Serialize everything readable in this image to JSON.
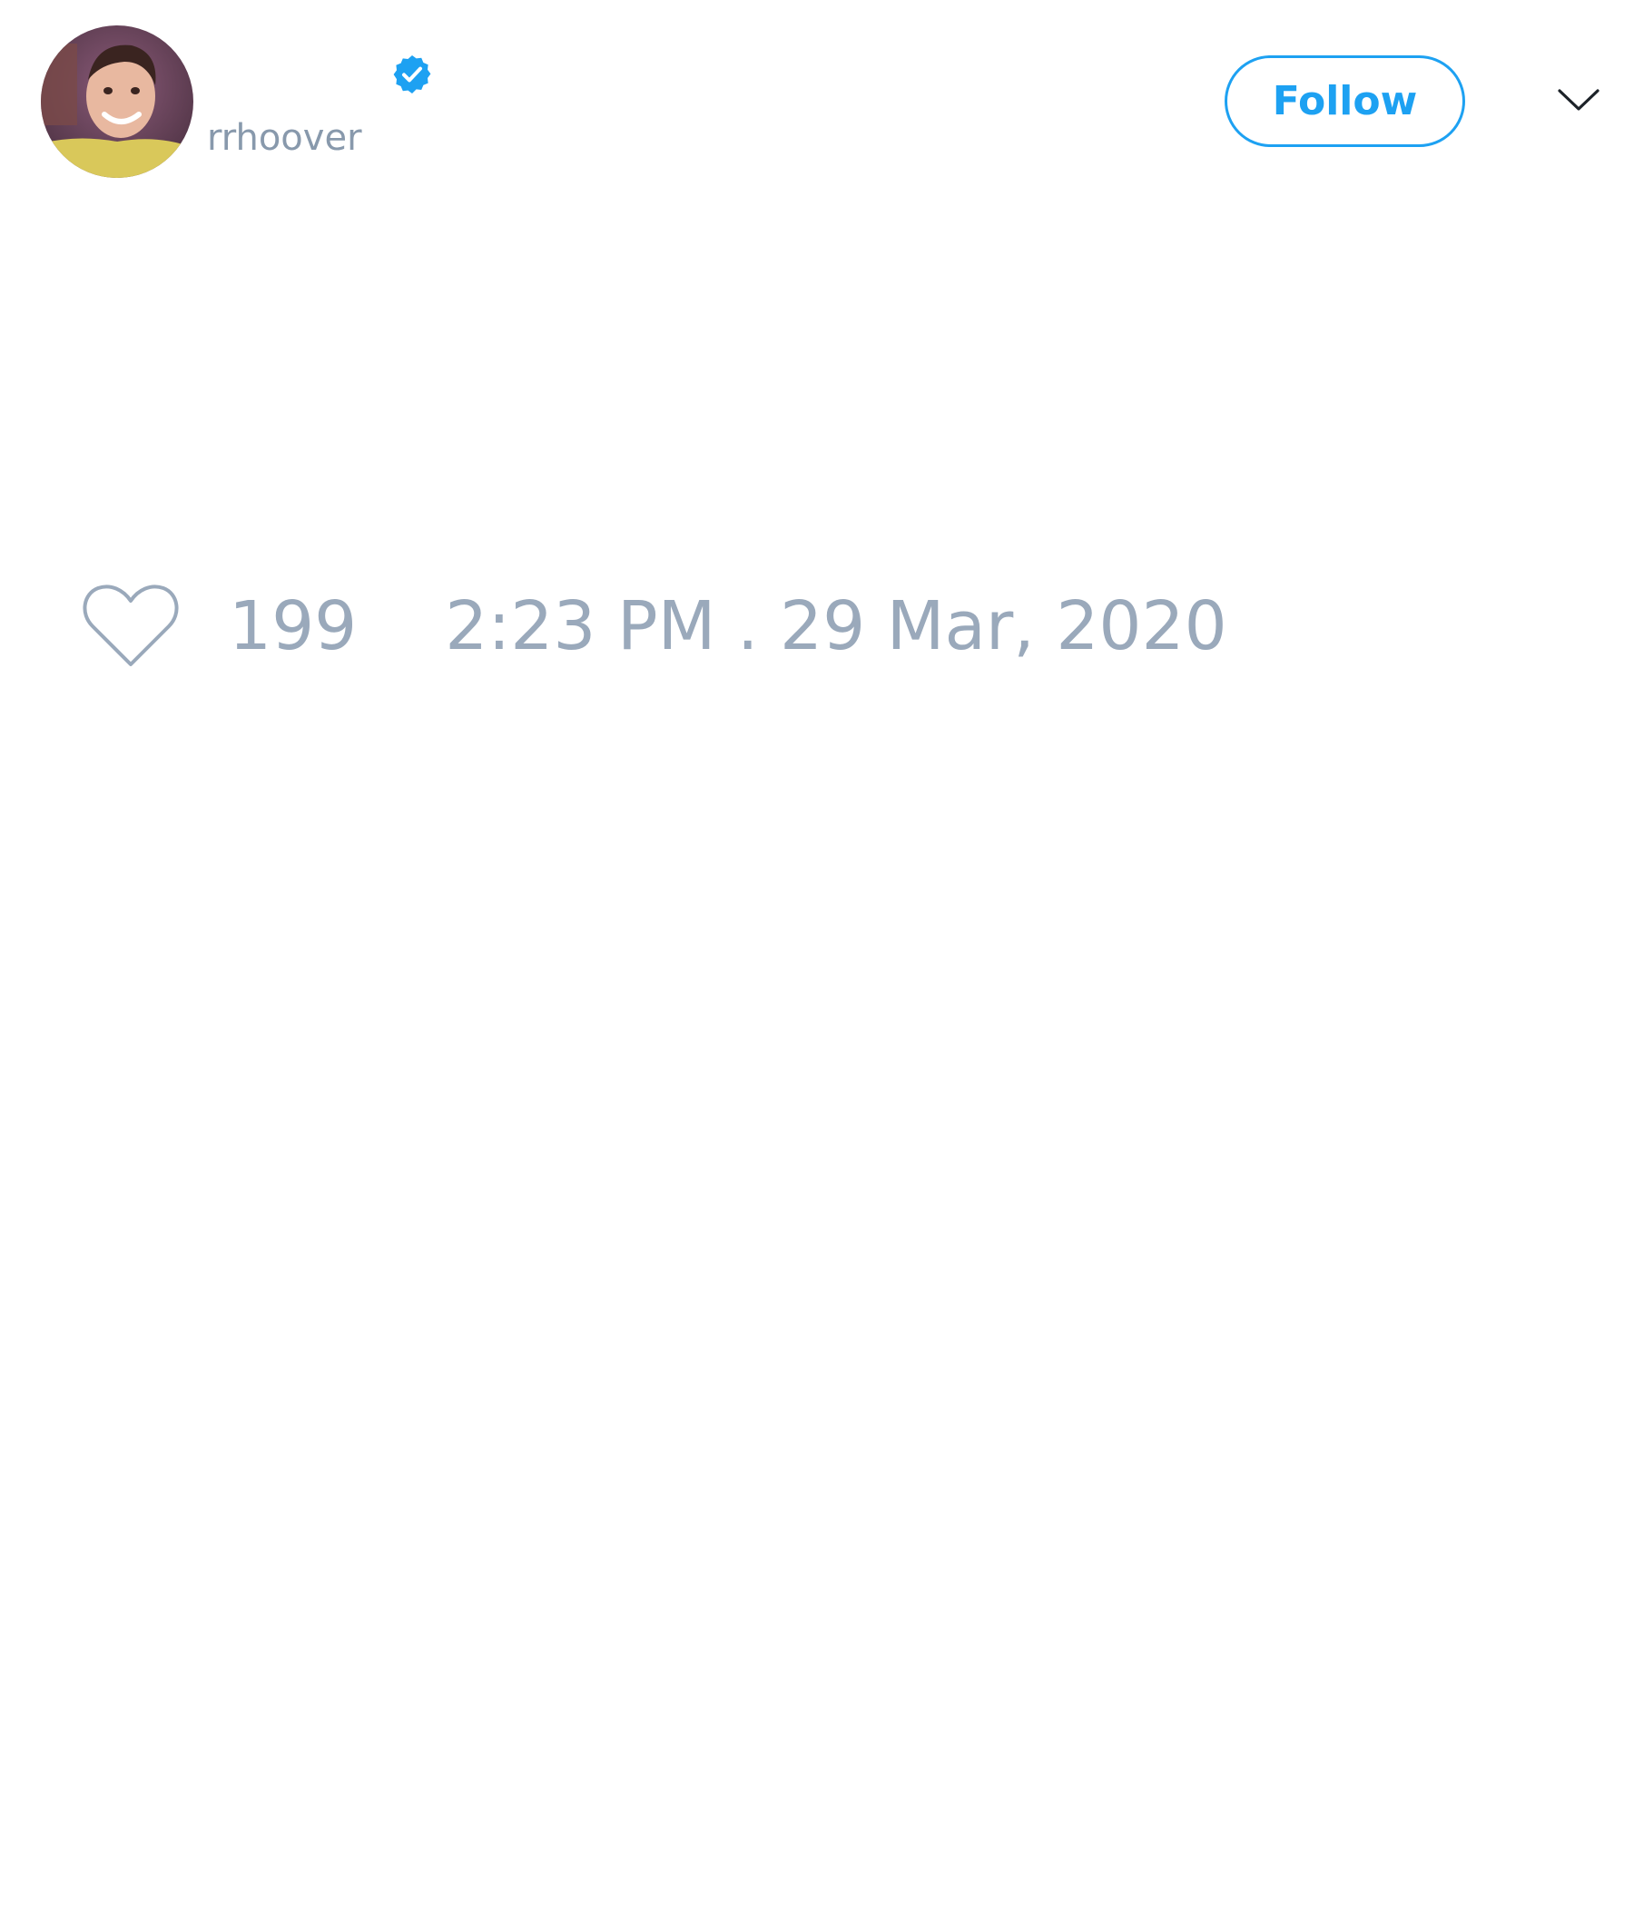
{
  "tweet": {
    "author": {
      "handle": "rrhoover",
      "verified": true
    },
    "follow_button": "Follow",
    "likes": "199",
    "timestamp": "2:23 PM . 29 Mar, 2020"
  },
  "icons": {
    "verified": "verified-badge-icon",
    "menu": "chevron-down-icon",
    "like": "heart-outline-icon"
  },
  "colors": {
    "accent": "#1da1f2",
    "muted_text": "#8899ac",
    "meta_text": "#9aa9bb"
  }
}
